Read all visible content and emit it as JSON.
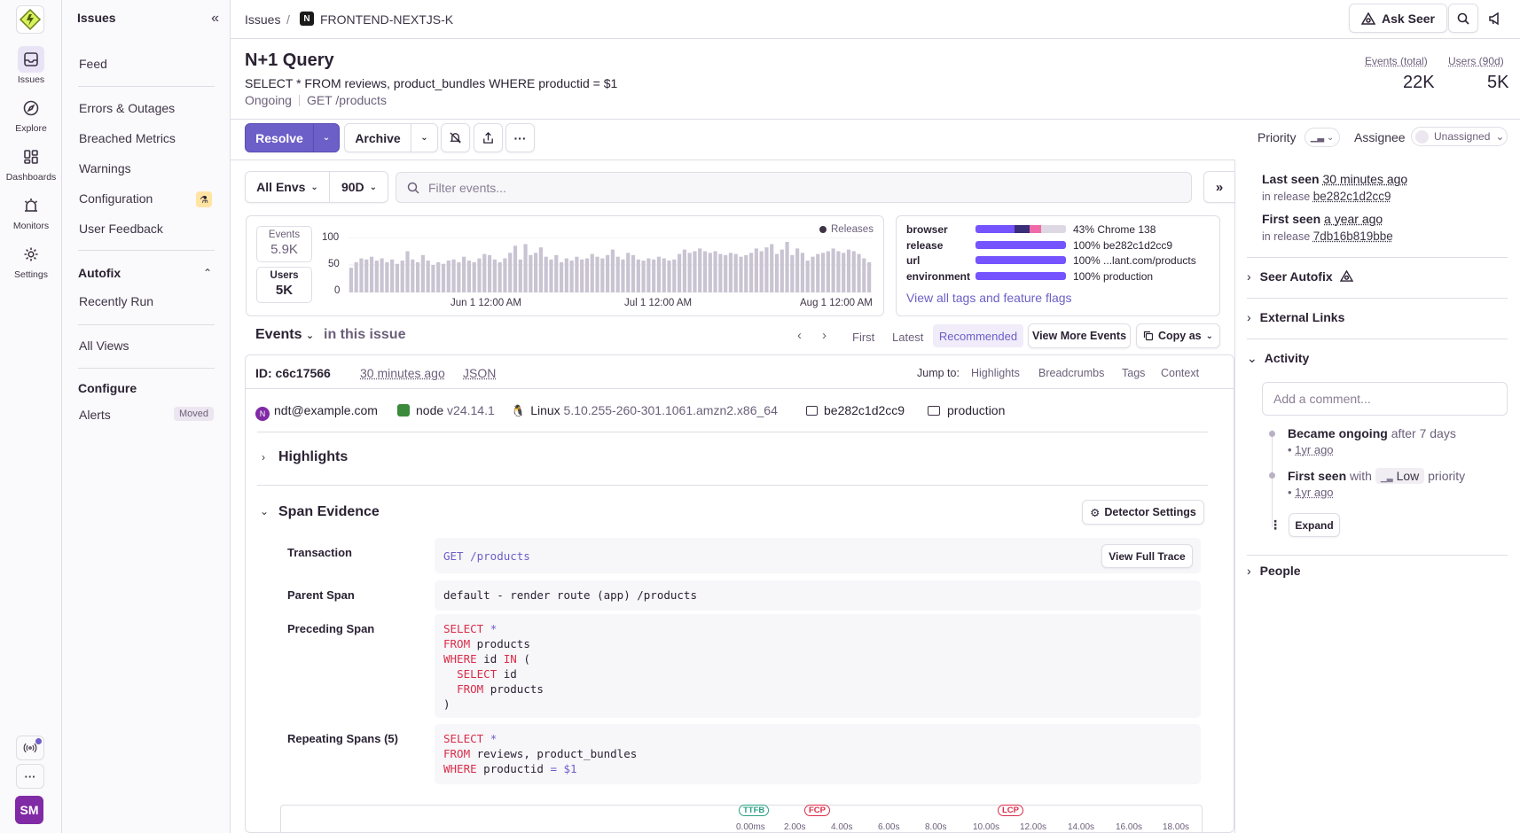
{
  "rail": {
    "items": [
      {
        "label": "Issues"
      },
      {
        "label": "Explore"
      },
      {
        "label": "Dashboards"
      },
      {
        "label": "Monitors"
      },
      {
        "label": "Settings"
      }
    ],
    "avatar_initials": "SM"
  },
  "secnav": {
    "title": "Issues",
    "items": {
      "feed": "Feed",
      "errors": "Errors & Outages",
      "breached": "Breached Metrics",
      "warnings": "Warnings",
      "configuration": "Configuration",
      "user_feedback": "User Feedback"
    },
    "autofix_head": "Autofix",
    "recently_run": "Recently Run",
    "all_views": "All Views",
    "configure_head": "Configure",
    "alerts": "Alerts",
    "moved_badge": "Moved"
  },
  "topbar": {
    "crumb_root": "Issues",
    "crumb_sep": "/",
    "project_letter": "N",
    "crumb_project": "FRONTEND-NEXTJS-K",
    "ask_seer": "Ask Seer"
  },
  "issue": {
    "title": "N+1 Query",
    "subtitle": "SELECT * FROM reviews, product_bundles WHERE productid = $1",
    "status": "Ongoing",
    "route": "GET /products",
    "events_label": "Events (total)",
    "events_value": "22K",
    "users_label": "Users (90d)",
    "users_value": "5K"
  },
  "actions": {
    "resolve": "Resolve",
    "archive": "Archive",
    "more": "···",
    "priority_label": "Priority",
    "assignee_label": "Assignee",
    "assignee_value": "Unassigned"
  },
  "filters": {
    "env": "All Envs",
    "period": "90D",
    "search_placeholder": "Filter events..."
  },
  "chart": {
    "events_label": "Events",
    "events_value": "5.9K",
    "users_label": "Users",
    "users_value": "5K",
    "legend": "Releases",
    "y_ticks": [
      "100",
      "50",
      "0"
    ],
    "x_ticks": [
      "Jun 1 12:00 AM",
      "Jul 1 12:00 AM",
      "Aug 1 12:00 AM"
    ]
  },
  "chart_data": {
    "type": "bar",
    "ylim": [
      0,
      100
    ],
    "y_ticks": [
      0,
      50,
      100
    ],
    "x_ticks": [
      "Jun 1 12:00 AM",
      "Jul 1 12:00 AM",
      "Aug 1 12:00 AM"
    ],
    "values": [
      45,
      55,
      62,
      60,
      65,
      58,
      62,
      55,
      60,
      52,
      58,
      75,
      60,
      55,
      68,
      58,
      50,
      55,
      52,
      58,
      60,
      55,
      65,
      58,
      55,
      62,
      70,
      68,
      60,
      55,
      62,
      72,
      85,
      60,
      88,
      68,
      72,
      82,
      65,
      60,
      68,
      55,
      62,
      58,
      65,
      60,
      62,
      70,
      65,
      62,
      68,
      78,
      65,
      60,
      72,
      68,
      60,
      58,
      62,
      60,
      65,
      62,
      58,
      60,
      70,
      78,
      72,
      75,
      80,
      75,
      72,
      75,
      70,
      68,
      72,
      70,
      65,
      68,
      72,
      80,
      75,
      82,
      88,
      70,
      78,
      92,
      68,
      80,
      72,
      58,
      65,
      70,
      72,
      75,
      80,
      75,
      72,
      78,
      75,
      70,
      62,
      55
    ]
  },
  "tags": [
    {
      "key": "browser",
      "value": "43% Chrome 138"
    },
    {
      "key": "release",
      "value": "100% be282c1d2cc9"
    },
    {
      "key": "url",
      "value": "100%   ...lant.com/products"
    },
    {
      "key": "environment",
      "value": "100% production"
    }
  ],
  "tag_colors": {
    "primary": "#7553ff",
    "secondary": "#3a2d7a",
    "tertiary": "#f06aa8",
    "rest": "#ddd8e3"
  },
  "tags_link": "View all tags and feature flags",
  "events": {
    "title": "Events",
    "subtitle": "in this issue",
    "first": "First",
    "latest": "Latest",
    "recommended": "Recommended",
    "view_more": "View More Events",
    "copy_as": "Copy as",
    "id": "ID: c6c17566",
    "time_ago": "30 minutes ago",
    "json": "JSON",
    "jump_to": "Jump to:",
    "jump_links": [
      "Highlights",
      "Breadcrumbs",
      "Tags",
      "Context"
    ]
  },
  "context": {
    "user_initial": "N",
    "user": "ndt@example.com",
    "runtime": "node",
    "runtime_version": "v24.14.1",
    "os": "Linux",
    "os_version": "5.10.255-260-301.1061.amzn2.x86_64",
    "release": "be282c1d2cc9",
    "environment": "production"
  },
  "sections": {
    "highlights": "Highlights",
    "span_evidence": "Span Evidence",
    "detector_settings": "Detector Settings"
  },
  "span": {
    "transaction_key": "Transaction",
    "transaction_value": "GET /products",
    "view_full_trace": "View Full Trace",
    "parent_key": "Parent Span",
    "parent_value": "default - render route (app) /products",
    "preceding_key": "Preceding Span",
    "repeating_key": "Repeating Spans (5)"
  },
  "timeline": {
    "markers": [
      "TTFB",
      "FCP",
      "LCP"
    ],
    "ticks": [
      "0.00ms",
      "2.00s",
      "4.00s",
      "6.00s",
      "8.00s",
      "10.00s",
      "12.00s",
      "14.00s",
      "16.00s",
      "18.00s"
    ]
  },
  "sidebar": {
    "last_seen_label": "Last seen",
    "last_seen_value": "30 minutes ago",
    "last_release_prefix": "in release",
    "last_release": "be282c1d2cc9",
    "first_seen_label": "First seen",
    "first_seen_value": "a year ago",
    "first_release_prefix": "in release",
    "first_release": "7db16b819bbe",
    "seer_autofix": "Seer Autofix",
    "external_links": "External Links",
    "activity": "Activity",
    "comment_placeholder": "Add a comment...",
    "act1_bold": "Became ongoing",
    "act1_rest": "after 7 days",
    "act1_time": "1yr ago",
    "act2_bold": "First seen",
    "act2_with": "with",
    "act2_priority": "Low",
    "act2_rest": "priority",
    "act2_time": "1yr ago",
    "expand": "Expand",
    "people": "People"
  }
}
